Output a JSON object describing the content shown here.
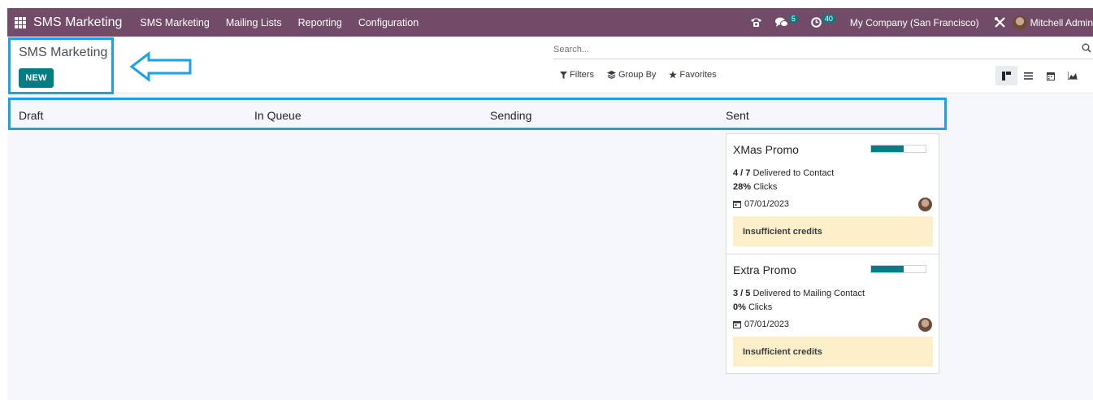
{
  "navbar": {
    "app_name": "SMS Marketing",
    "menu": [
      "SMS Marketing",
      "Mailing Lists",
      "Reporting",
      "Configuration"
    ],
    "messages_count": "5",
    "activities_count": "40",
    "company": "My Company (San Francisco)",
    "user": "Mitchell Admin"
  },
  "control": {
    "title": "SMS Marketing",
    "new_label": "NEW",
    "search_placeholder": "Search...",
    "filters_label": "Filters",
    "groupby_label": "Group By",
    "favorites_label": "Favorites"
  },
  "columns": [
    "Draft",
    "In Queue",
    "Sending",
    "Sent"
  ],
  "cards": [
    {
      "title": "XMas Promo",
      "progress": 0.6,
      "delivered": "4 / 7",
      "delivered_text": "Delivered to Contact",
      "clicks": "28%",
      "clicks_text": "Clicks",
      "date": "07/01/2023",
      "warning": "Insufficient credits"
    },
    {
      "title": "Extra Promo",
      "progress": 0.6,
      "delivered": "3 / 5",
      "delivered_text": "Delivered to Mailing Contact",
      "clicks": "0%",
      "clicks_text": "Clicks",
      "date": "07/01/2023",
      "warning": "Insufficient credits"
    }
  ],
  "colors": {
    "navbar": "#714b67",
    "primary": "#017e84",
    "highlight": "#1ea0e6",
    "warning_bg": "#fcefc9"
  }
}
